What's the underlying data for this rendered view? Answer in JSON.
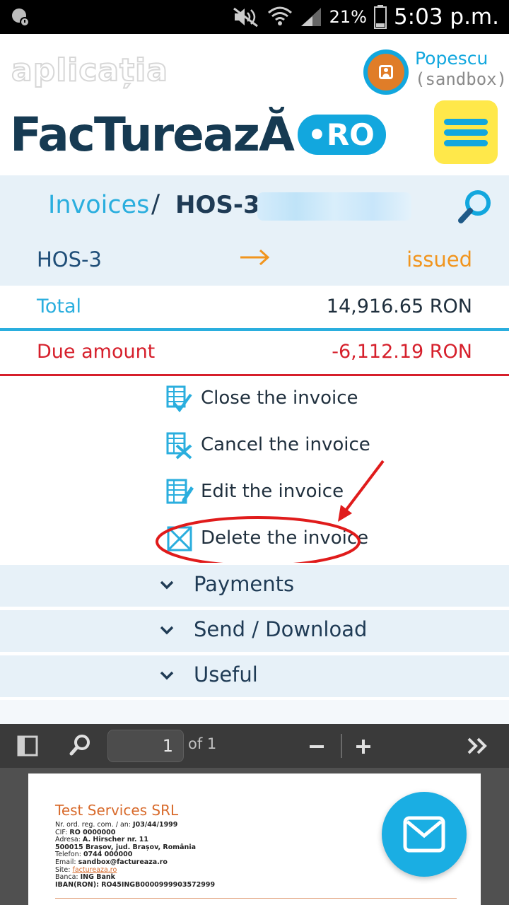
{
  "status_bar": {
    "battery": "21%",
    "time": "5:03 p.m."
  },
  "header": {
    "app_label": "aplicația",
    "brand_name": "FacTureazĂ",
    "brand_suffix": "•RO",
    "user": {
      "name": "Popescu",
      "role": "(sandbox)"
    }
  },
  "breadcrumb": {
    "parent": "Invoices",
    "separator": "/",
    "current": "HOS-3"
  },
  "invoice": {
    "id": "HOS-3",
    "arrow": "→",
    "status": "issued",
    "total_label": "Total",
    "total_value": "14,916.65 RON",
    "due_label": "Due amount",
    "due_value": "-6,112.19 RON"
  },
  "actions": [
    {
      "label": "Close the invoice",
      "icon": "close-invoice-icon"
    },
    {
      "label": "Cancel the invoice",
      "icon": "cancel-invoice-icon"
    },
    {
      "label": "Edit the invoice",
      "icon": "edit-invoice-icon"
    },
    {
      "label": "Delete the invoice",
      "icon": "delete-invoice-icon"
    }
  ],
  "sections": [
    {
      "label": "Payments"
    },
    {
      "label": "Send / Download"
    },
    {
      "label": "Useful"
    }
  ],
  "pdf_viewer": {
    "page": "1",
    "of_label": "of 1"
  },
  "document": {
    "company": "Test Services SRL",
    "lines": {
      "reg_label": "Nr. ord. reg. com. / an:",
      "reg_value": "J03/44/1999",
      "cif_label": "CIF:",
      "cif_value": "RO 0000000",
      "addr_label": "Adresa:",
      "addr_value": "A. Hirscher nr. 11",
      "city_value": "500015 Brașov, jud. Brașov, România",
      "phone_label": "Telefon:",
      "phone_value": "0744 000000",
      "email_label": "Email:",
      "email_value": "sandbox@factureaza.ro",
      "site_label": "Site:",
      "site_value": "factureaza.ro",
      "bank_label": "Banca:",
      "bank_value": "ING Bank",
      "iban_value": "IBAN(RON): RO45INGB0000999903572999"
    }
  },
  "colors": {
    "brand_blue": "#12a7de",
    "navy": "#1f3b55",
    "issued_orange": "#f1951e",
    "due_red": "#d61f2b",
    "menu_yellow": "#ffe84a"
  }
}
